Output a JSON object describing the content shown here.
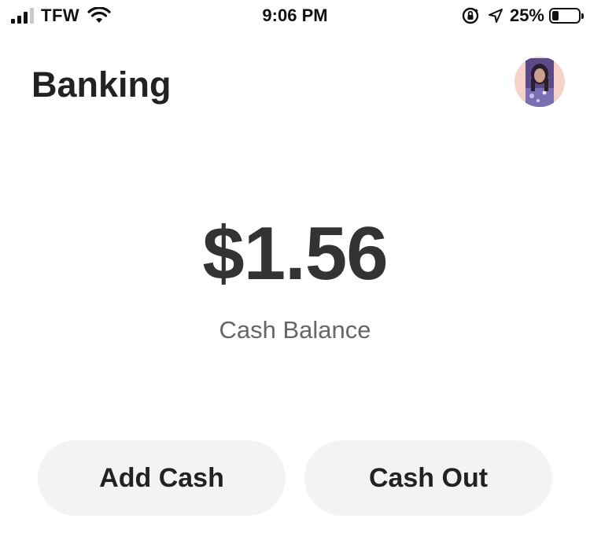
{
  "status_bar": {
    "carrier": "TFW",
    "time": "9:06 PM",
    "battery_percent": "25%",
    "battery_level": 0.25,
    "icons": [
      "signal-icon",
      "wifi-icon",
      "orientation-lock-icon",
      "location-arrow-icon",
      "battery-icon"
    ]
  },
  "header": {
    "title": "Banking"
  },
  "balance": {
    "amount": "$1.56",
    "label": "Cash Balance"
  },
  "actions": {
    "add_cash": "Add Cash",
    "cash_out": "Cash Out"
  },
  "colors": {
    "background": "#ffffff",
    "text_primary": "#222222",
    "text_secondary": "#666666",
    "button_bg": "#f3f3f3",
    "avatar_bg": "#f6d3c9"
  }
}
